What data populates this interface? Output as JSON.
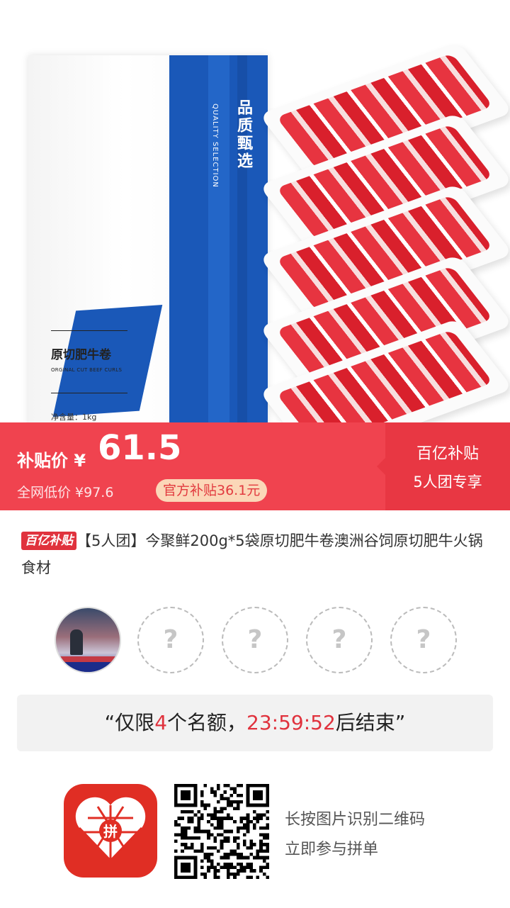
{
  "product_image": {
    "bag_quality_cn": "品质甄选",
    "bag_quality_en": "QUALITY SELECTION",
    "bag_name_cn": "原切肥牛卷",
    "bag_name_en": "ORGINAL CUT BEEF CURLS",
    "bag_net_weight": "净含量：1kg"
  },
  "price_banner": {
    "subsidy_label": "补贴价 ¥",
    "price": "61.5",
    "market_price": "全网低价 ¥97.6",
    "official_subsidy": "官方补贴36.1元",
    "program_title": "百亿补贴",
    "program_sub": "5人团专享"
  },
  "title": {
    "tag": "百亿补贴",
    "text": "【5人团】今聚鲜200g*5袋原切肥牛卷澳洲谷饲原切肥牛火锅食材"
  },
  "group": {
    "empty_mark": "?"
  },
  "countdown": {
    "prefix": "“仅限",
    "slots": "4",
    "middle": "个名额，",
    "time": "23:59:52",
    "suffix": "后结束”"
  },
  "footer": {
    "logo_text": "拼",
    "line1": "长按图片识别二维码",
    "line2": "立即参与拼单"
  },
  "colors": {
    "accent_red": "#f0434f",
    "brand_blue": "#1a58b8"
  }
}
